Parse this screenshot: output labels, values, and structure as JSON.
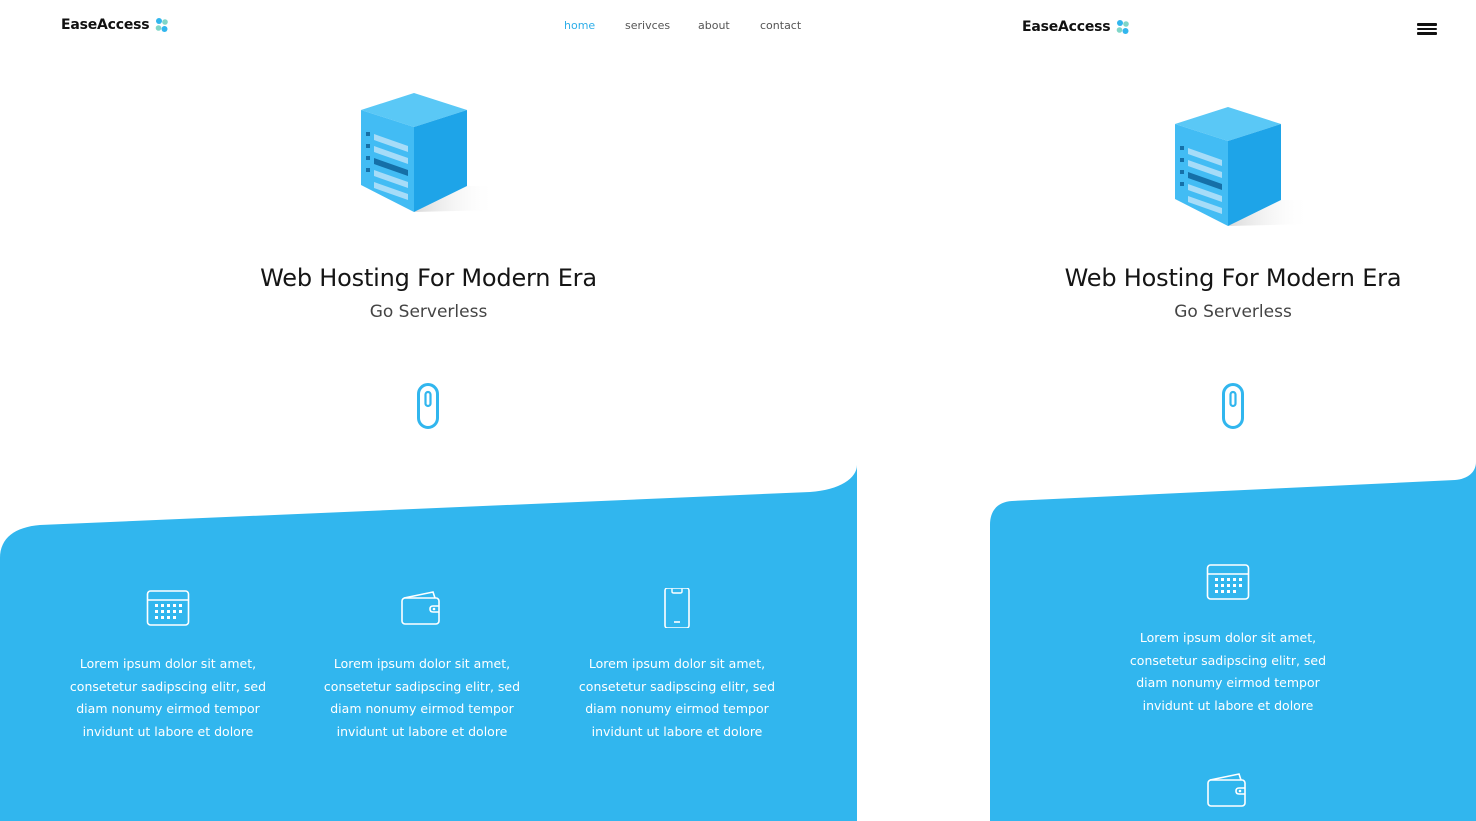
{
  "brand": {
    "name": "EaseAccess",
    "accent_color": "#2eaee9",
    "logo_icon": "dots-cluster-icon"
  },
  "nav": {
    "items": [
      {
        "label": "home",
        "active": true
      },
      {
        "label": "serivces",
        "active": false
      },
      {
        "label": "about",
        "active": false
      },
      {
        "label": "contact",
        "active": false
      }
    ]
  },
  "hero": {
    "illustration": "server-cube-icon",
    "title": "Web Hosting For Modern Era",
    "subtitle": "Go Serverless",
    "scroll_icon": "scroll-mouse-icon"
  },
  "features": [
    {
      "icon": "calendar-icon",
      "text": [
        "Lorem ipsum dolor sit amet,",
        "consetetur sadipscing elitr, sed",
        "diam nonumy eirmod tempor",
        "invidunt ut labore et dolore"
      ]
    },
    {
      "icon": "wallet-icon",
      "text": [
        "Lorem ipsum dolor sit amet,",
        "consetetur sadipscing elitr, sed",
        "diam nonumy eirmod tempor",
        "invidunt ut labore et dolore"
      ]
    },
    {
      "icon": "smartphone-icon",
      "text": [
        "Lorem ipsum dolor sit amet,",
        "consetetur sadipscing elitr, sed",
        "diam nonumy eirmod tempor",
        "invidunt ut labore et dolore"
      ]
    }
  ],
  "mobile": {
    "menu_icon": "hamburger-menu-icon"
  },
  "colors": {
    "section_blue": "#31b6ee",
    "cube_light": "#5ac8f6",
    "cube_dark": "#1ea4e8",
    "text_dark": "#151515"
  }
}
